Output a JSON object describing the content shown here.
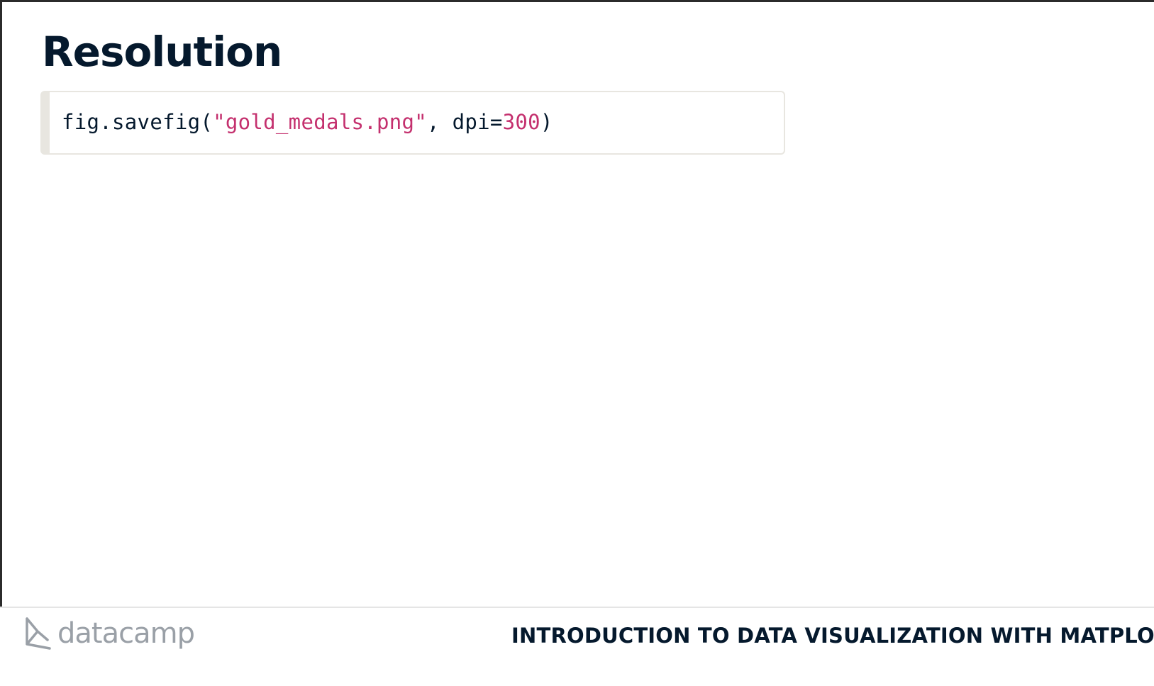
{
  "slide": {
    "title": "Resolution"
  },
  "code": {
    "tokens": [
      {
        "type": "plain",
        "text": "fig.savefig("
      },
      {
        "type": "str",
        "text": "\"gold_medals.png\""
      },
      {
        "type": "plain",
        "text": ", dpi="
      },
      {
        "type": "num",
        "text": "300"
      },
      {
        "type": "plain",
        "text": ")"
      }
    ]
  },
  "footer": {
    "logo_text": "datacamp",
    "logo_icon": "datacamp-logo-icon",
    "course_title": "INTRODUCTION TO DATA VISUALIZATION WITH MATPLOTLIB"
  },
  "colors": {
    "heading": "#05192d",
    "code_literal": "#c4306e",
    "code_border": "#e8e6e0",
    "logo_gray": "#9aa0a7"
  }
}
